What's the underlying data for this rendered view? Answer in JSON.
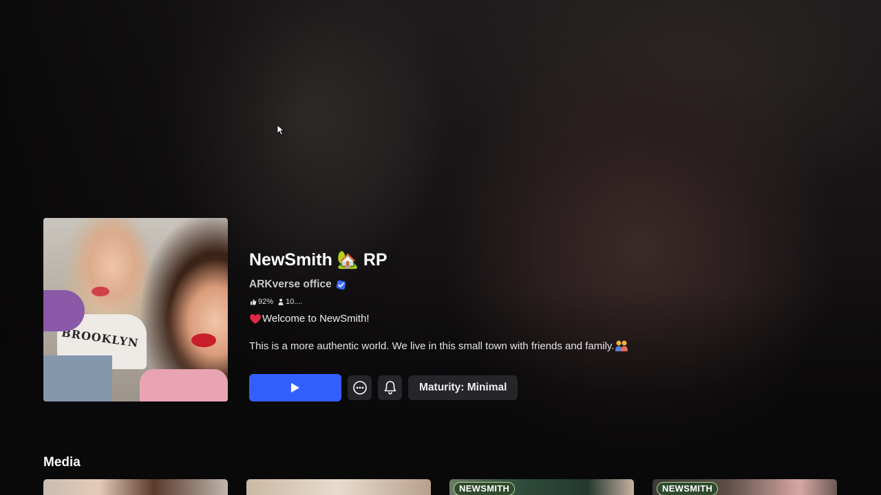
{
  "game": {
    "title": "NewSmith 🏡 RP",
    "creator": "ARKverse office",
    "rating": "92%",
    "players": "10....",
    "welcome": "Welcome to NewSmith!",
    "description": "This is a more authentic world. We live in this small town with friends and family."
  },
  "actions": {
    "maturity_label": "Maturity: Minimal"
  },
  "thumbnail": {
    "shirt_text": "BROOKLYN"
  },
  "media": {
    "heading": "Media",
    "items": [
      {
        "badge": ""
      },
      {
        "badge": ""
      },
      {
        "badge": "NEWSMITH"
      },
      {
        "badge": "NEWSMITH"
      }
    ]
  },
  "colors": {
    "accent": "#335fff",
    "verified": "#3b6bff",
    "heart": "#e0284a",
    "button_bg": "#25252a"
  },
  "icons": [
    "cursor-icon",
    "verified-icon",
    "thumbs-up-icon",
    "person-icon",
    "heart-icon",
    "family-icon",
    "play-icon",
    "more-icon",
    "bell-icon"
  ]
}
